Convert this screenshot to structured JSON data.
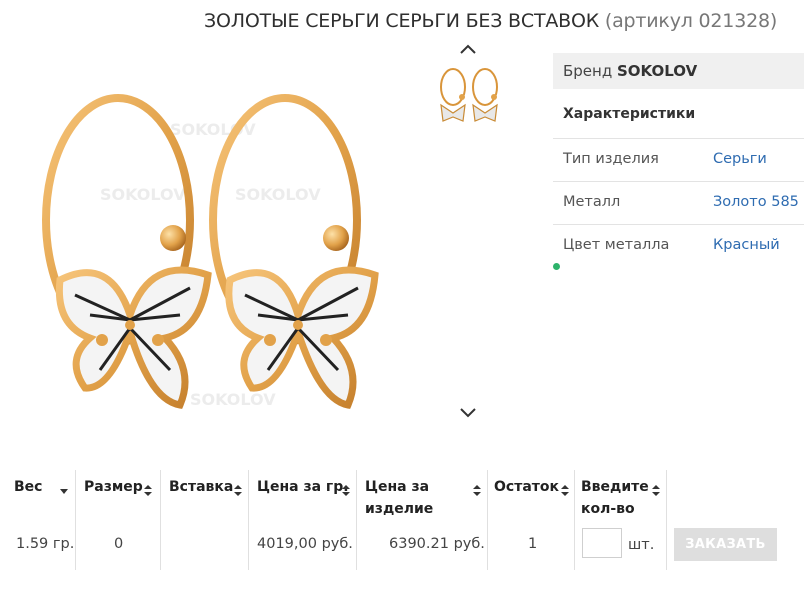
{
  "product": {
    "title": "ЗОЛОТЫЕ СЕРЬГИ СЕРЬГИ БЕЗ ВСТАВОК",
    "sku_text": "(артикул 021328)",
    "watermark": "SOKOLOV"
  },
  "brand": {
    "label": "Бренд",
    "value": "SOKOLOV"
  },
  "specs": {
    "heading": "Характеристики",
    "rows": [
      {
        "label": "Тип изделия",
        "value": "Серьги"
      },
      {
        "label": "Металл",
        "value": "Золото 585"
      },
      {
        "label": "Цвет металла",
        "value": "Красный"
      }
    ]
  },
  "table": {
    "headers": [
      "Вес",
      "Размер",
      "Вставка",
      "Цена за гр.",
      "Цена за изделие",
      "Остаток",
      "Введите кол-во"
    ],
    "row": {
      "weight": "1.59 гр.",
      "size": "0",
      "insert": "",
      "price_per_gram": "4019,00 руб.",
      "price_per_item": "6390.21 руб.",
      "stock": "1"
    },
    "qty_unit": "шт.",
    "order_button": "ЗАКАЗАТЬ"
  },
  "colors": {
    "link": "#2f6cb1",
    "gold": "#e2a24a",
    "status_dot": "#2db36b",
    "button_bg": "#dedede"
  },
  "icons": [
    "chevron-up-icon",
    "chevron-down-icon",
    "sort-icon",
    "sort-down-icon"
  ]
}
